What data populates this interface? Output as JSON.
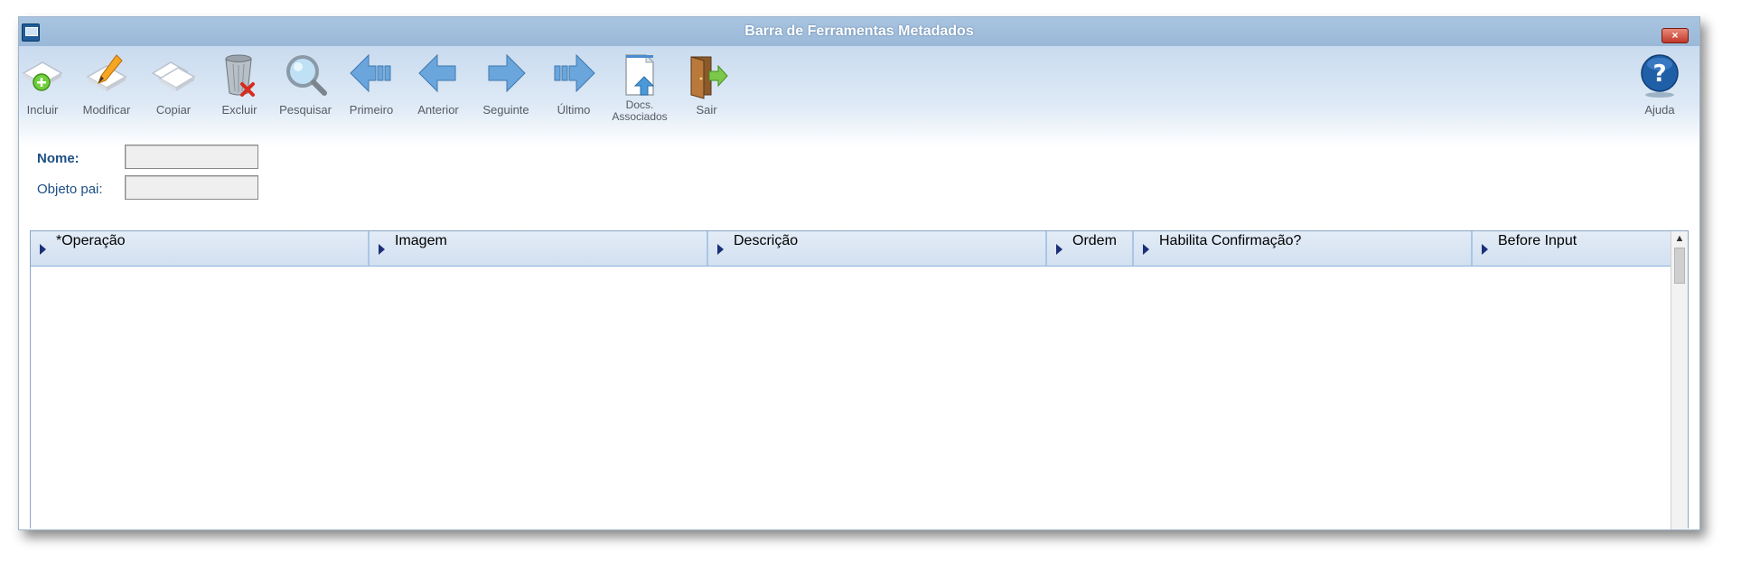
{
  "window": {
    "title": "Barra de Ferramentas Metadados",
    "close_label": "×"
  },
  "toolbar": {
    "incluir": "Incluir",
    "modificar": "Modificar",
    "copiar": "Copiar",
    "excluir": "Excluir",
    "pesquisar": "Pesquisar",
    "primeiro": "Primeiro",
    "anterior": "Anterior",
    "seguinte": "Seguinte",
    "ultimo": "Último",
    "docs_line1": "Docs.",
    "docs_line2": "Associados",
    "sair": "Sair",
    "ajuda": "Ajuda"
  },
  "form": {
    "nome_label": "Nome:",
    "nome_value": "",
    "objeto_pai_label": "Objeto pai:",
    "objeto_pai_value": ""
  },
  "grid": {
    "columns": [
      "*Operação",
      "Imagem",
      "Descrição",
      "Ordem",
      "Habilita Confirmação?",
      "Before Input"
    ],
    "scroll_up": "▲"
  },
  "icons": {
    "incluir": "add-document-icon",
    "modificar": "edit-pencil-icon",
    "copiar": "copy-pages-icon",
    "excluir": "trash-delete-icon",
    "pesquisar": "magnifier-icon",
    "primeiro": "first-arrow-icon",
    "anterior": "previous-arrow-icon",
    "seguinte": "next-arrow-icon",
    "ultimo": "last-arrow-icon",
    "docs": "document-upload-icon",
    "sair": "exit-door-icon",
    "ajuda": "help-question-icon"
  },
  "colors": {
    "title_bar": "#a8c4e0",
    "label_blue": "#1d4f85",
    "arrow_blue": "#6aa6dc",
    "help_blue": "#1f5fa8"
  }
}
